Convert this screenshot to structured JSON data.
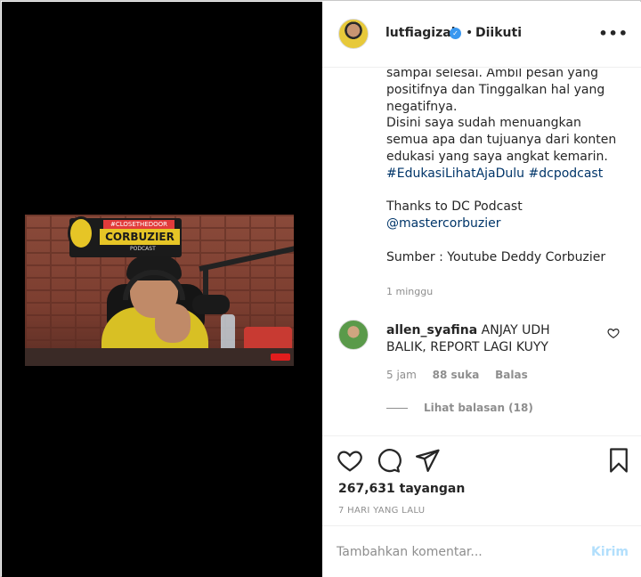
{
  "post": {
    "username": "lutfiagizal",
    "verified_icon": "verified-badge-icon",
    "separator": "•",
    "follow_status": "Diikuti",
    "more_label": "•••"
  },
  "video": {
    "logo_top": "#CLOSETHEDOOR",
    "logo_main": "CORBUZIER",
    "logo_sub": "PODCAST"
  },
  "caption": {
    "text": "sampai selesai. Ambil pesan yang positifnya dan Tinggalkan hal yang negatifnya.\nDisini saya sudah menuangkan semua apa dan tujuanya dari konten edukasi yang saya angkat kemarin.",
    "hashtags": "#EdukasiLihatAjaDulu #dcpodcast",
    "thanks": "Thanks to DC Podcast",
    "mention": "@mastercorbuzier",
    "source": "Sumber : Youtube Deddy Corbuzier",
    "time": "1 minggu"
  },
  "comment": {
    "username": "allen_syafina",
    "text": "ANJAY UDH BALIK, REPORT LAGI KUYY",
    "time": "5 jam",
    "likes": "88 suka",
    "reply": "Balas",
    "view_replies": "Lihat balasan (18)"
  },
  "actions": {
    "views": "267,631 tayangan",
    "date": "7 HARI YANG LALU"
  },
  "add_comment": {
    "placeholder": "Tambahkan komentar...",
    "post_label": "Kirim"
  },
  "colors": {
    "link": "#003569",
    "verified": "#3897f0",
    "secondary_text": "#8e8e8e",
    "post_button": "#b2dffc"
  }
}
